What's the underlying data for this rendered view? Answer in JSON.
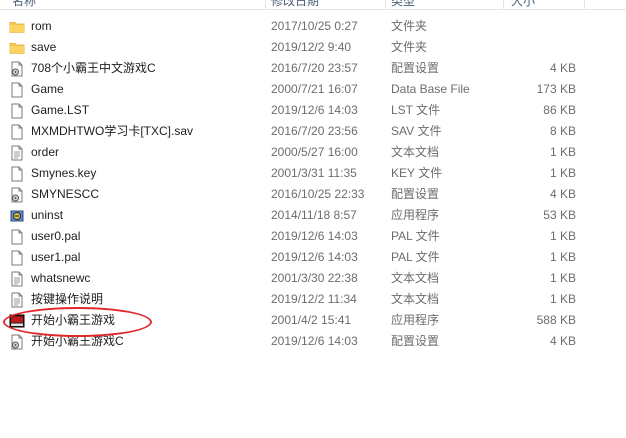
{
  "header": {
    "columns": [
      {
        "label": "名称"
      },
      {
        "label": "修改日期"
      },
      {
        "label": "类型"
      },
      {
        "label": "大小"
      }
    ]
  },
  "files": [
    {
      "name": "rom",
      "date": "2017/10/25 0:27",
      "type": "文件夹",
      "size": "",
      "icon": "folder-icon"
    },
    {
      "name": "save",
      "date": "2019/12/2 9:40",
      "type": "文件夹",
      "size": "",
      "icon": "folder-icon"
    },
    {
      "name": "708个小霸王中文游戏C",
      "date": "2016/7/20 23:57",
      "type": "配置设置",
      "size": "4 KB",
      "icon": "settings-file-icon"
    },
    {
      "name": "Game",
      "date": "2000/7/21 16:07",
      "type": "Data Base File",
      "size": "173 KB",
      "icon": "file-icon"
    },
    {
      "name": "Game.LST",
      "date": "2019/12/6 14:03",
      "type": "LST 文件",
      "size": "86 KB",
      "icon": "file-icon"
    },
    {
      "name": "MXMDHTWO学习卡[TXC].sav",
      "date": "2016/7/20 23:56",
      "type": "SAV 文件",
      "size": "8 KB",
      "icon": "file-icon"
    },
    {
      "name": "order",
      "date": "2000/5/27 16:00",
      "type": "文本文档",
      "size": "1 KB",
      "icon": "text-file-icon"
    },
    {
      "name": "Smynes.key",
      "date": "2001/3/31 11:35",
      "type": "KEY 文件",
      "size": "1 KB",
      "icon": "file-icon"
    },
    {
      "name": "SMYNESCC",
      "date": "2016/10/25 22:33",
      "type": "配置设置",
      "size": "4 KB",
      "icon": "settings-file-icon"
    },
    {
      "name": "uninst",
      "date": "2014/11/18 8:57",
      "type": "应用程序",
      "size": "53 KB",
      "icon": "uninstall-app-icon"
    },
    {
      "name": "user0.pal",
      "date": "2019/12/6 14:03",
      "type": "PAL 文件",
      "size": "1 KB",
      "icon": "file-icon"
    },
    {
      "name": "user1.pal",
      "date": "2019/12/6 14:03",
      "type": "PAL 文件",
      "size": "1 KB",
      "icon": "file-icon"
    },
    {
      "name": "whatsnewc",
      "date": "2001/3/30 22:38",
      "type": "文本文档",
      "size": "1 KB",
      "icon": "text-file-icon"
    },
    {
      "name": "按键操作说明",
      "date": "2019/12/2 11:34",
      "type": "文本文档",
      "size": "1 KB",
      "icon": "text-file-icon"
    },
    {
      "name": "开始小霸王游戏",
      "date": "2001/4/2 15:41",
      "type": "应用程序",
      "size": "588 KB",
      "icon": "game-app-icon"
    },
    {
      "name": "开始小霸王游戏C",
      "date": "2019/12/6 14:03",
      "type": "配置设置",
      "size": "4 KB",
      "icon": "settings-file-icon"
    }
  ],
  "colors": {
    "folder": "#f7c648",
    "annotation": "#e0282a",
    "header_text": "#4c607a"
  }
}
